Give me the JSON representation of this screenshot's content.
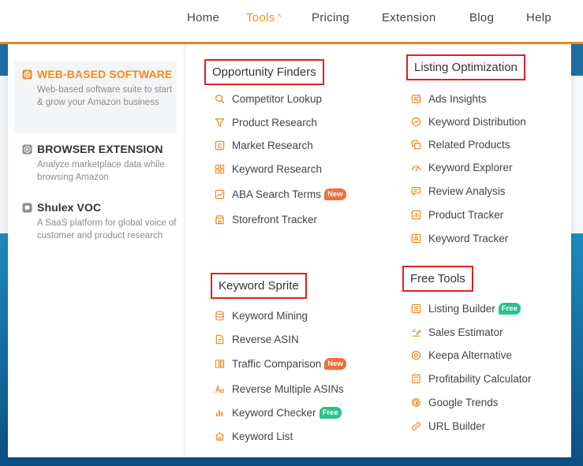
{
  "nav": {
    "home": "Home",
    "tools": "Tools",
    "tools_caret": "^",
    "pricing": "Pricing",
    "extension": "Extension",
    "blog": "Blog",
    "help": "Help"
  },
  "colors": {
    "accent": "#f28a1d",
    "highlight_box": "#e02020",
    "new_badge": "#f26d3d",
    "free_badge": "#27c48a"
  },
  "left": {
    "web": {
      "title": "WEB-BASED SOFTWARE",
      "desc": "Web-based software suite to start & grow your Amazon business",
      "icon": "globe-icon"
    },
    "browser": {
      "title": "BROWSER EXTENSION",
      "desc": "Analyze marketplace data while browsing Amazon",
      "icon": "chrome-icon"
    },
    "voc": {
      "title": "Shulex VOC",
      "desc": "A SaaS platform for global voice of customer and product research",
      "icon": "voc-icon"
    }
  },
  "opportunity": {
    "title": "Opportunity Finders",
    "items": [
      {
        "label": "Competitor Lookup",
        "icon": "search-icon"
      },
      {
        "label": "Product Research",
        "icon": "filter-icon"
      },
      {
        "label": "Market Research",
        "icon": "market-icon"
      },
      {
        "label": "Keyword Research",
        "icon": "grid-icon"
      },
      {
        "label": "ABA Search Terms",
        "icon": "chart-icon",
        "badge": "New"
      },
      {
        "label": "Storefront Tracker",
        "icon": "store-icon"
      }
    ]
  },
  "listing": {
    "title": "Listing Optimization",
    "items": [
      {
        "label": "Ads Insights",
        "icon": "ads-icon"
      },
      {
        "label": "Keyword Distribution",
        "icon": "distribution-icon"
      },
      {
        "label": "Related Products",
        "icon": "copy-icon"
      },
      {
        "label": "Keyword Explorer",
        "icon": "explorer-icon"
      },
      {
        "label": "Review Analysis",
        "icon": "comment-icon"
      },
      {
        "label": "Product Tracker",
        "icon": "bar-chart-icon"
      },
      {
        "label": "Keyword Tracker",
        "icon": "tracker-icon"
      }
    ]
  },
  "sprite": {
    "title": "Keyword Sprite",
    "items": [
      {
        "label": "Keyword Mining",
        "icon": "database-icon"
      },
      {
        "label": "Reverse ASIN",
        "icon": "document-icon"
      },
      {
        "label": "Traffic Comparison",
        "icon": "columns-icon",
        "badge": "New"
      },
      {
        "label": "Reverse Multiple ASINs",
        "icon": "letters-icon"
      },
      {
        "label": "Keyword Checker",
        "icon": "checker-icon",
        "badge": "Free"
      },
      {
        "label": "Keyword List",
        "icon": "home-icon"
      }
    ]
  },
  "free": {
    "title": "Free Tools",
    "items": [
      {
        "label": "Listing Builder",
        "icon": "list-icon",
        "badge": "Free"
      },
      {
        "label": "Sales Estimator",
        "icon": "edit-icon"
      },
      {
        "label": "Keepa Alternative",
        "icon": "target-icon"
      },
      {
        "label": "Profitability Calculator",
        "icon": "calculator-icon"
      },
      {
        "label": "Google Trends",
        "icon": "google-icon"
      },
      {
        "label": "URL Builder",
        "icon": "link-icon"
      }
    ]
  }
}
